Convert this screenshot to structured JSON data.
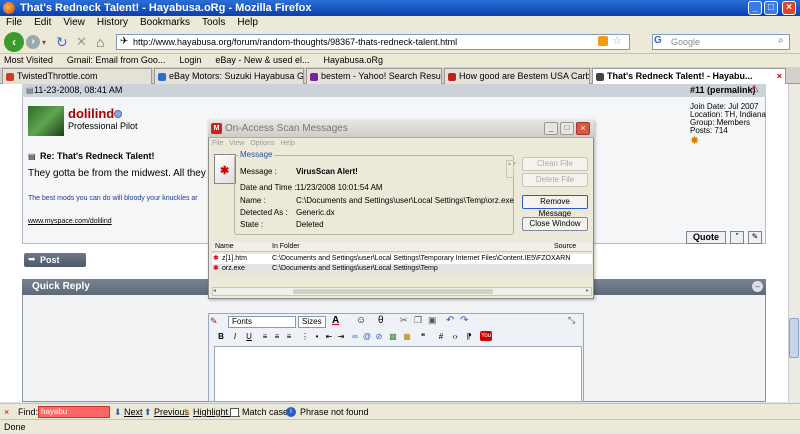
{
  "window": {
    "title": "That's Redneck Talent! - Hayabusa.oRg - Mozilla Firefox"
  },
  "menu": [
    "File",
    "Edit",
    "View",
    "History",
    "Bookmarks",
    "Tools",
    "Help"
  ],
  "nav": {
    "url": "http://www.hayabusa.org/forum/random-thoughts/98367-thats-redneck-talent.html",
    "search_placeholder": "Google"
  },
  "bookmarks": [
    "Most Visited",
    "Gmail: Email from Goo...",
    "Login",
    "eBay - New & used el...",
    "Hayabusa.oRg"
  ],
  "tabs": [
    {
      "label": "TwistedThrottle.com",
      "color": "#c9401f"
    },
    {
      "label": "eBay Motors: Suzuki Hayabusa GSXR13...",
      "color": "#2d6bd6"
    },
    {
      "label": "bestem - Yahoo! Search Results",
      "color": "#7b1fa2"
    },
    {
      "label": "How good are Bestem USA Carbon Fibe...",
      "color": "#c0201e"
    },
    {
      "label": "That's Redneck Talent! - Hayabu...",
      "color": "#444"
    }
  ],
  "post": {
    "date": "11-23-2008, 08:41 AM",
    "permalink": "#11 (permalink)",
    "username": "dolilind",
    "user_title": "Professional Pilot",
    "join_date": "Join Date: Jul 2007",
    "location": "Location: TH, Indiana",
    "group": "Group: Members",
    "posts": "Posts: 714",
    "subject": "Re: That's Redneck Talent!",
    "body": "They gotta be from the midwest. All they drink",
    "signature": "The best mods you can do will bloody your knuckles ar",
    "sig_link": "www.myspace.com/dolilind",
    "quote_label": "Quote"
  },
  "post_reply": "Post Reply",
  "quick_reply": "Quick Reply",
  "editor": {
    "fonts": "Fonts",
    "sizes": "Sizes"
  },
  "dialog": {
    "title": "On-Access Scan Messages",
    "menu": [
      "File",
      "View",
      "Options",
      "Help"
    ],
    "group_label": "Message",
    "message_label": "Message :",
    "message_value": "VirusScan Alert!",
    "datetime_label": "Date and Time :",
    "datetime_value": "11/23/2008 10:01:54 AM",
    "name_label": "Name :",
    "name_value": "C:\\Documents and Settings\\user\\Local Settings\\Temp\\orz.exe",
    "detected_label": "Detected As :",
    "detected_value": "Generic.dx",
    "state_label": "State :",
    "state_value": "Deleted",
    "btn_clean": "Clean File",
    "btn_delete": "Delete File",
    "btn_remove": "Remove Message",
    "btn_close": "Close Window",
    "col_name": "Name",
    "col_folder": "In Folder",
    "col_source": "Source",
    "rows": [
      {
        "name": "z[1].htm",
        "folder": "C:\\Documents and Settings\\user\\Local Settings\\Temporary Internet Files\\Content.IE5\\FZOXARN"
      },
      {
        "name": "orz.exe",
        "folder": "C:\\Documents and Settings\\user\\Local Settings\\Temp"
      }
    ]
  },
  "find": {
    "label": "Find:",
    "value": "hayabu",
    "next": "Next",
    "previous": "Previous",
    "highlight": "Highlight all",
    "matchcase": "Match case",
    "status": "Phrase not found"
  },
  "status": "Done"
}
